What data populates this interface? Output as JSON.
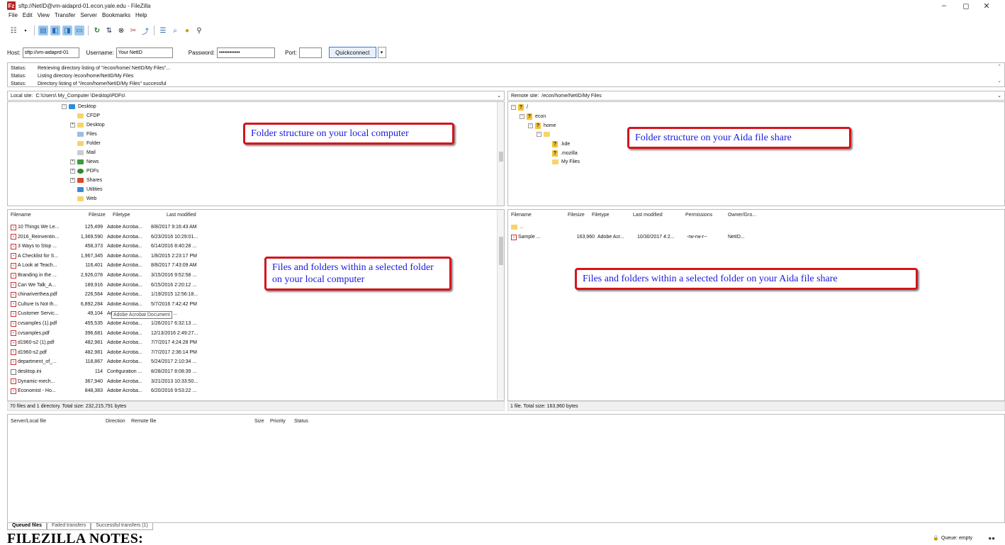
{
  "window": {
    "title": "sftp://NetID@vm-aidaprd-01.econ.yale.edu - FileZilla",
    "controls": {
      "minimize": "–",
      "maximize": "◻",
      "close": "✕"
    }
  },
  "menu": [
    "File",
    "Edit",
    "View",
    "Transfer",
    "Server",
    "Bookmarks",
    "Help"
  ],
  "quickconnect": {
    "host_label": "Host:",
    "host_value": "sftp://vm-aidaprd-01",
    "username_label": "Username:",
    "username_value": "Your NetID",
    "password_label": "Password:",
    "password_value": "••••••••••••",
    "port_label": "Port:",
    "port_value": "",
    "button": "Quickconnect"
  },
  "status_log": [
    {
      "key": "Status:",
      "msg": "Retrieving directory listing of \"/econ/home/ NetID/My Files\"..."
    },
    {
      "key": "Status:",
      "msg": "Listing directory /econ/home/NetID/My Files"
    },
    {
      "key": "Status:",
      "msg": "Directory listing of \"/econ/home/NetID/My Files\" successful"
    }
  ],
  "local": {
    "site_label": "Local site:",
    "site_value": "C:\\Users\\ My_Computer \\Desktop\\PDFs\\",
    "tree": [
      "Desktop",
      "CFDP",
      "Desktop",
      "Files",
      "Folder",
      "Mail",
      "News",
      "PDFs",
      "Shares",
      "Utilities",
      "Web"
    ],
    "headers": {
      "name": "Filename",
      "size": "Filesize",
      "type": "Filetype",
      "modified": "Last modified"
    },
    "files": [
      {
        "name": "10 Things We Le...",
        "size": "125,499",
        "type": "Adobe Acroba...",
        "modified": "8/8/2017 9:16:43 AM"
      },
      {
        "name": "2016_Reinventin...",
        "size": "1,369,590",
        "type": "Adobe Acroba...",
        "modified": "6/23/2016 10:29:01..."
      },
      {
        "name": "3 Ways to Stop ...",
        "size": "458,373",
        "type": "Adobe Acroba...",
        "modified": "6/14/2016 8:40:28 ..."
      },
      {
        "name": "A Checklist for S...",
        "size": "1,967,345",
        "type": "Adobe Acroba...",
        "modified": "1/8/2015 2:23:17 PM"
      },
      {
        "name": "A Look at Teach...",
        "size": "116,401",
        "type": "Adobe Acroba...",
        "modified": "8/8/2017 7:43:09 AM"
      },
      {
        "name": "Branding in the ...",
        "size": "2,926,078",
        "type": "Adobe Acroba...",
        "modified": "3/15/2016 9:52:58 ..."
      },
      {
        "name": "Can We Talk_A...",
        "size": "189,916",
        "type": "Adobe Acroba...",
        "modified": "6/15/2016 2:20:12 ..."
      },
      {
        "name": "chinariverthea.pdf",
        "size": "226,564",
        "type": "Adobe Acroba...",
        "modified": "1/19/2015 12:56:18..."
      },
      {
        "name": "Culture Is Not th...",
        "size": "6,892,284",
        "type": "Adobe Acroba...",
        "modified": "5/7/2016 7:42:42 PM"
      },
      {
        "name": "Customer Servic...",
        "size": "49,104",
        "type": "Adobe Acrobat Document",
        "modified": "8 9:29:46 ..."
      },
      {
        "name": "cvsamples (1).pdf",
        "size": "455,535",
        "type": "Adobe Acroba...",
        "modified": "1/26/2017 6:32:13 ..."
      },
      {
        "name": "cvsamples.pdf",
        "size": "396,681",
        "type": "Adobe Acroba...",
        "modified": "12/13/2016 2:49:27..."
      },
      {
        "name": "d1960-s2 (1).pdf",
        "size": "482,981",
        "type": "Adobe Acroba...",
        "modified": "7/7/2017 4:24:28 PM"
      },
      {
        "name": "d1960-s2.pdf",
        "size": "482,981",
        "type": "Adobe Acroba...",
        "modified": "7/7/2017 2:36:14 PM"
      },
      {
        "name": "department_of_...",
        "size": "118,867",
        "type": "Adobe Acroba...",
        "modified": "5/24/2017 2:10:34 ..."
      },
      {
        "name": "desktop.ini",
        "size": "114",
        "type": "Configuration ...",
        "modified": "8/28/2017 8:08:39 ..."
      },
      {
        "name": "Dynamic-mech...",
        "size": "367,940",
        "type": "Adobe Acroba...",
        "modified": "3/21/2013 10:33:50..."
      },
      {
        "name": "Economist - Ho...",
        "size": "848,383",
        "type": "Adobe Acroba...",
        "modified": "6/20/2016 9:53:22 ..."
      }
    ],
    "summary": "70 files and 1 directory. Total size: 232,215,791 bytes"
  },
  "remote": {
    "site_label": "Remote site:",
    "site_value": "/econ/home/NetID/My Files",
    "tree": [
      "/",
      "econ",
      "home",
      ".kde",
      ".mozilla",
      "My Files"
    ],
    "headers": {
      "name": "Filename",
      "size": "Filesize",
      "type": "Filetype",
      "modified": "Last modified",
      "perms": "Permissions",
      "owner": "Owner/Gro..."
    },
    "parent": "..",
    "files": [
      {
        "name": "Sample ...",
        "size": "163,960",
        "type": "Adobe Acr...",
        "modified": "10/30/2017 4:2...",
        "perms": "-rw-rw-r--",
        "owner": "NetID..."
      }
    ],
    "summary": "1 file. Total size: 163,960 bytes"
  },
  "callouts": {
    "local_tree": "Folder structure on your local computer",
    "remote_tree": "Folder structure on your Aida file share",
    "local_files": "Files and folders within a selected folder on your local computer",
    "remote_files": "Files and folders within a selected folder on your Aida file share"
  },
  "queue": {
    "headers": {
      "server": "Server/Local file",
      "direction": "Direction",
      "remote": "Remote file",
      "size": "Size",
      "priority": "Priority",
      "status": "Status"
    },
    "tabs": [
      "Queued files",
      "Failed transfers",
      "Successful transfers (1)"
    ],
    "status": "Queue: empty"
  },
  "notes_heading": "FILEZILLA NOTES:"
}
